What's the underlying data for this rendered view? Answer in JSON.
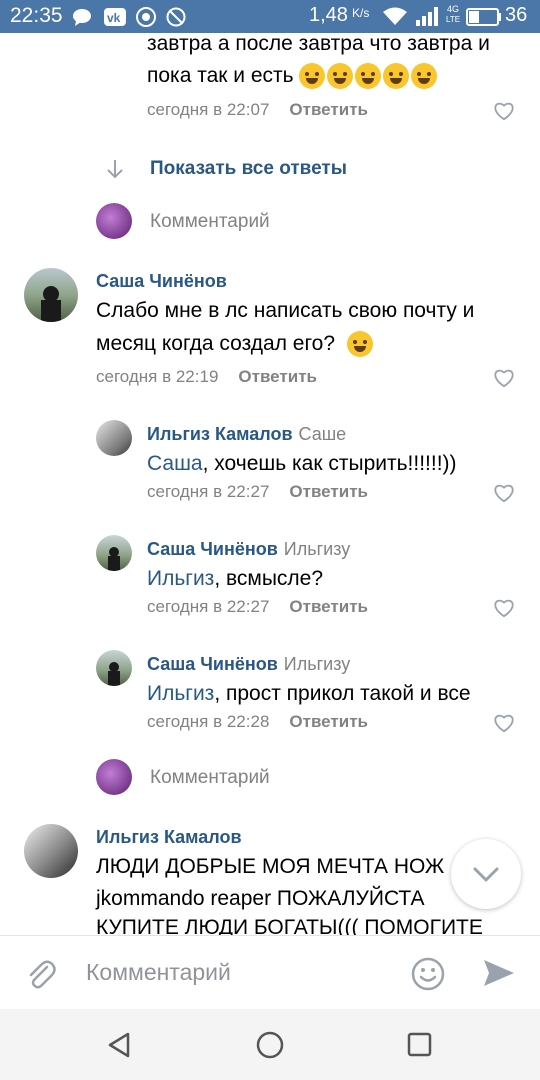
{
  "status_bar": {
    "time": "22:35",
    "network_speed": "1,48",
    "network_speed_unit": "K/s",
    "network_type_top": "4G",
    "network_type_bottom": "LTE",
    "battery": "36"
  },
  "thread": {
    "top_comment_tail": {
      "line1": "завтра а после завтра что завтра и",
      "line2": "пока так и есть",
      "time": "сегодня в 22:07",
      "reply": "Ответить"
    },
    "show_all_replies": "Показать все ответы",
    "comment_placeholder_1": "Комментарий",
    "comment_placeholder_2": "Комментарий",
    "comments": [
      {
        "author": "Саша Чинёнов",
        "text_line1": "Слабо мне в лс написать свою почту и",
        "text_line2": "месяц когда создал его?",
        "time": "сегодня в 22:19",
        "reply": "Ответить"
      }
    ],
    "replies": [
      {
        "author": "Ильгиз Камалов",
        "addressee": "Саше",
        "mention": "Саша",
        "text": ", хочешь как стырить!!!!!!))",
        "time": "сегодня в 22:27",
        "reply": "Ответить"
      },
      {
        "author": "Саша Чинёнов",
        "addressee": "Ильгизу",
        "mention": "Ильгиз",
        "text": ", всмысле?",
        "time": "сегодня в 22:27",
        "reply": "Ответить"
      },
      {
        "author": "Саша Чинёнов",
        "addressee": "Ильгизу",
        "mention": "Ильгиз",
        "text": ", прост прикол такой и все",
        "time": "сегодня в 22:28",
        "reply": "Ответить"
      }
    ],
    "last_comment": {
      "author": "Ильгиз Камалов",
      "line1": "ЛЮДИ ДОБРЫЕ МОЯ МЕЧТА НОЖ",
      "line2": "jkommando   reaper ПОЖАЛУЙСТА",
      "line3": "КУПИТЕ ЛЮДИ БОГАТЫ((( ПОМОГИТЕ"
    }
  },
  "input": {
    "placeholder": "Комментарий"
  },
  "icons": {
    "attach": "paperclip-icon",
    "emoji": "smiley-icon",
    "send": "send-icon",
    "back": "nav-back-icon",
    "home": "nav-home-icon",
    "recents": "nav-recents-icon"
  },
  "colors": {
    "brand": "#4a76a8",
    "link": "#2a5885",
    "meta": "#828282"
  }
}
